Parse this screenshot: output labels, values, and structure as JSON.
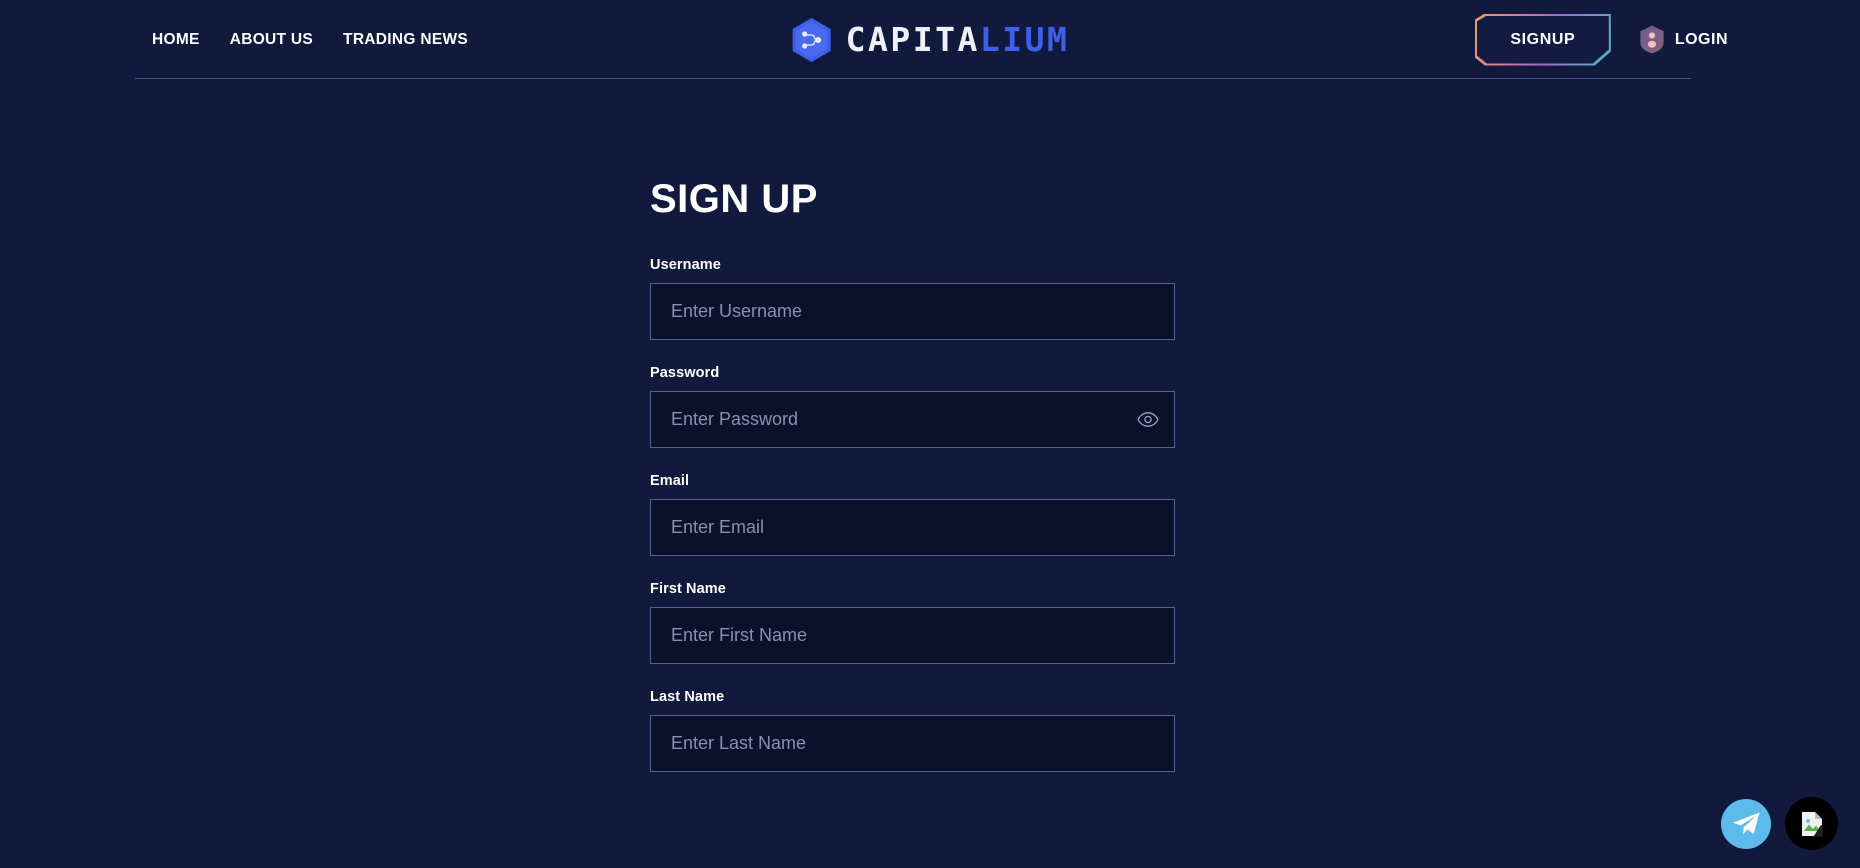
{
  "header": {
    "nav": [
      {
        "label": "HOME",
        "name": "nav-link-home"
      },
      {
        "label": "ABOUT US",
        "name": "nav-link-about-us"
      },
      {
        "label": "TRADING NEWS",
        "name": "nav-link-trading-news"
      }
    ],
    "brand": {
      "text_light": "CAPITA",
      "text_accent": "LIUM",
      "full": "CAPITALIUM",
      "logo_icon": "hexagon-network-icon"
    },
    "signup_label": "SIGNUP",
    "login_label": "LOGIN",
    "login_icon": "shield-user-icon"
  },
  "main": {
    "title": "SIGN UP",
    "fields": [
      {
        "label": "Username",
        "placeholder": "Enter Username",
        "value": "",
        "type": "text",
        "name": "username"
      },
      {
        "label": "Password",
        "placeholder": "Enter Password",
        "value": "",
        "type": "password",
        "name": "password",
        "toggle_icon": "eye-icon"
      },
      {
        "label": "Email",
        "placeholder": "Enter Email",
        "value": "",
        "type": "email",
        "name": "email"
      },
      {
        "label": "First Name",
        "placeholder": "Enter First Name",
        "value": "",
        "type": "text",
        "name": "first-name"
      },
      {
        "label": "Last Name",
        "placeholder": "Enter Last Name",
        "value": "",
        "type": "text",
        "name": "last-name"
      }
    ]
  },
  "floating": {
    "telegram_icon": "telegram-paper-plane-icon",
    "chat_icon": "broken-image-icon"
  },
  "colors": {
    "page_background": "#111a3d",
    "input_background": "#0b112b",
    "input_border": "#545f92",
    "brand_accent": "#3f5fe8",
    "divider": "#4a548c",
    "gradient_start": "#e8a066",
    "gradient_mid": "#a06cc8",
    "gradient_end": "#4fb6c8",
    "telegram_blue": "#5fbaec",
    "placeholder_text": "#8890ac"
  }
}
